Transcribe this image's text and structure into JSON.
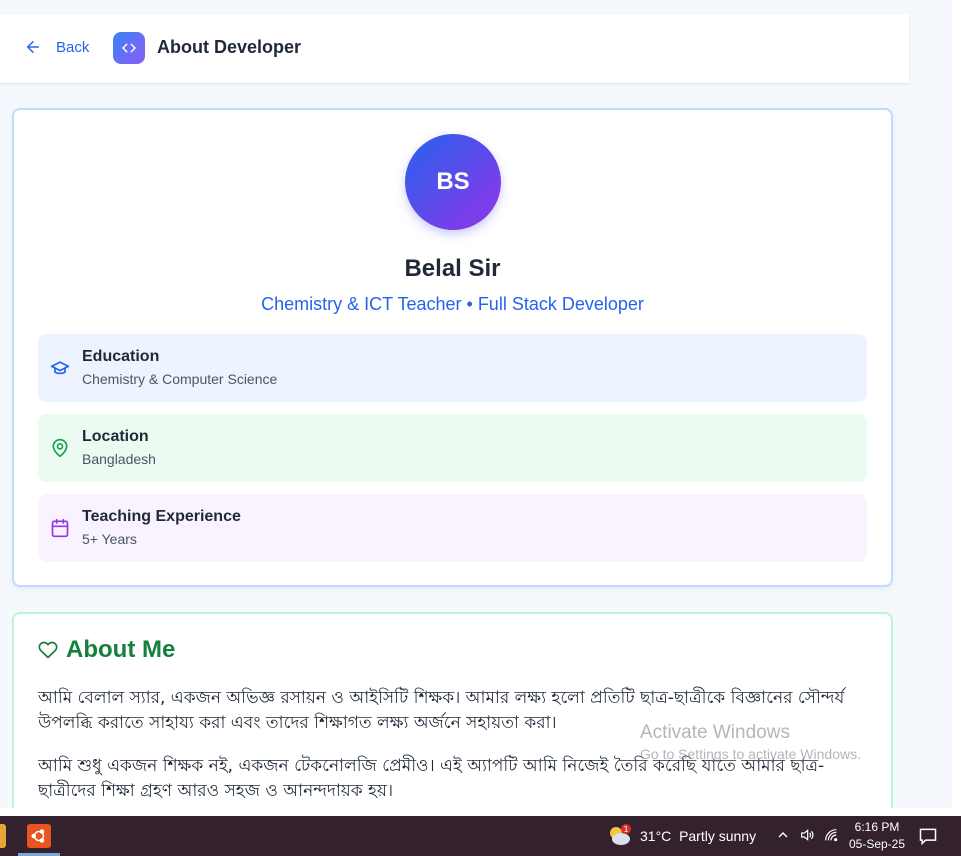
{
  "header": {
    "back_label": "Back",
    "title": "About Developer"
  },
  "profile": {
    "initials": "BS",
    "name": "Belal Sir",
    "role": "Chemistry & ICT Teacher • Full Stack Developer",
    "info": [
      {
        "title": "Education",
        "value": "Chemistry & Computer Science",
        "icon": "graduation-cap-icon",
        "color": "#2563eb"
      },
      {
        "title": "Location",
        "value": "Bangladesh",
        "icon": "map-pin-icon",
        "color": "#16a34a"
      },
      {
        "title": "Teaching Experience",
        "value": "5+ Years",
        "icon": "calendar-icon",
        "color": "#9333ea"
      }
    ]
  },
  "about": {
    "title": "About Me",
    "paragraphs": [
      "আমি বেলাল স্যার, একজন অভিজ্ঞ রসায়ন ও আইসিটি শিক্ষক। আমার লক্ষ্য হলো প্রতিটি ছাত্র-ছাত্রীকে বিজ্ঞানের সৌন্দর্য উপলব্ধি করাতে সাহায্য করা এবং তাদের শিক্ষাগত লক্ষ্য অর্জনে সহায়তা করা।",
      "আমি শুধু একজন শিক্ষক নই, একজন টেকনোলজি প্রেমীও। এই অ্যাপটি আমি নিজেই তৈরি করেছি যাতে আমার ছাত্র-ছাত্রীদের শিক্ষা গ্রহণ আরও সহজ ও আনন্দদায়ক হয়।"
    ]
  },
  "watermark": {
    "line1": "Activate Windows",
    "line2": "Go to Settings to activate Windows."
  },
  "taskbar": {
    "weather_badge": "1",
    "temperature": "31°C",
    "condition": "Partly sunny",
    "time": "6:16 PM",
    "date": "05-Sep-25"
  },
  "colors": {
    "accent_blue": "#2563eb",
    "accent_green": "#15803d",
    "accent_purple": "#9333ea",
    "taskbar_bg": "#33222e"
  }
}
